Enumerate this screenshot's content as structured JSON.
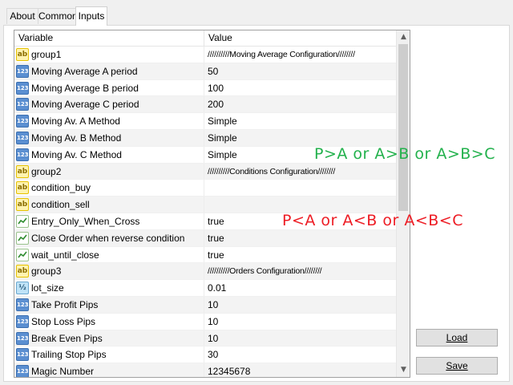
{
  "tabs": [
    {
      "label": "About",
      "active": false
    },
    {
      "label": "Common",
      "active": false
    },
    {
      "label": "Inputs",
      "active": true
    }
  ],
  "grid": {
    "header": {
      "variable": "Variable",
      "value": "Value"
    },
    "rows": [
      {
        "icon": "ab",
        "name": "group1",
        "value": "//////////Moving Average Configuration////////"
      },
      {
        "icon": "123",
        "name": "Moving Average A period",
        "value": "50"
      },
      {
        "icon": "123",
        "name": "Moving Average B period",
        "value": "100"
      },
      {
        "icon": "123",
        "name": "Moving Average C period",
        "value": "200"
      },
      {
        "icon": "123",
        "name": "Moving Av. A Method",
        "value": "Simple"
      },
      {
        "icon": "123",
        "name": "Moving Av. B Method",
        "value": "Simple"
      },
      {
        "icon": "123",
        "name": "Moving Av. C Method",
        "value": "Simple"
      },
      {
        "icon": "ab",
        "name": "group2",
        "value": "//////////Conditions Configuration////////"
      },
      {
        "icon": "ab",
        "name": "condition_buy",
        "value": "",
        "color": "#22b14c"
      },
      {
        "icon": "ab",
        "name": "condition_sell",
        "value": "",
        "color": "#ed1c24"
      },
      {
        "icon": "bool",
        "name": "Entry_Only_When_Cross",
        "value": "true"
      },
      {
        "icon": "bool",
        "name": "Close Order when reverse condition",
        "value": "true"
      },
      {
        "icon": "bool",
        "name": "wait_until_close",
        "value": "true"
      },
      {
        "icon": "ab",
        "name": "group3",
        "value": "//////////Orders Configuration////////"
      },
      {
        "icon": "dbl",
        "name": "lot_size",
        "value": "0.01"
      },
      {
        "icon": "123",
        "name": "Take Profit Pips",
        "value": "10"
      },
      {
        "icon": "123",
        "name": "Stop Loss Pips",
        "value": "10"
      },
      {
        "icon": "123",
        "name": "Break Even Pips",
        "value": "10"
      },
      {
        "icon": "123",
        "name": "Trailing Stop Pips",
        "value": "30"
      },
      {
        "icon": "123",
        "name": "Magic Number",
        "value": "12345678"
      }
    ]
  },
  "buttons": {
    "load": "Load",
    "save": "Save"
  },
  "annotations": {
    "buy": {
      "text": "P>A or A>B or A>B>C",
      "color": "#22b14c"
    },
    "sell": {
      "text": "P<A or A<B or A<B<C",
      "color": "#ed1c24"
    }
  }
}
